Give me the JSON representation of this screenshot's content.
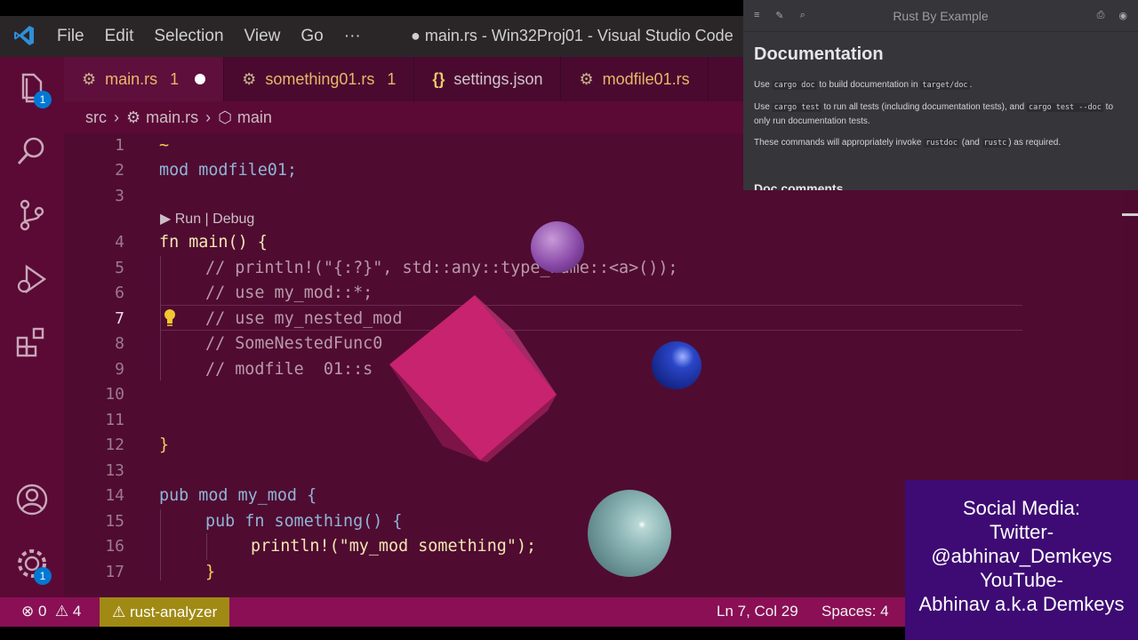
{
  "window": {
    "title": "● main.rs - Win32Proj01 - Visual Studio Code",
    "menu": [
      "File",
      "Edit",
      "Selection",
      "View",
      "Go",
      "···"
    ]
  },
  "activity_bar": {
    "explorer_badge": "1",
    "settings_badge": "1"
  },
  "tabs": [
    {
      "label": "main.rs",
      "count": "1",
      "dirty": true
    },
    {
      "label": "something01.rs",
      "count": "1"
    },
    {
      "label": "settings.json"
    },
    {
      "label": "modfile01.rs"
    }
  ],
  "breadcrumb": {
    "folder": "src",
    "file": "main.rs",
    "symbol": "main"
  },
  "editor": {
    "code_lens": "▶ Run | Debug",
    "lines": [
      {
        "n": "1",
        "text": "~"
      },
      {
        "n": "2",
        "text": "mod modfile01;"
      },
      {
        "n": "3",
        "text": ""
      },
      {
        "n": "4",
        "text": "fn main() {"
      },
      {
        "n": "5",
        "text": "// println!(\"{:?}\", std::any::type_name::<a>());"
      },
      {
        "n": "6",
        "text": "// use my_mod::*;"
      },
      {
        "n": "7",
        "text": "// use my_nested_mod"
      },
      {
        "n": "8",
        "text": "// SomeNestedFunc0"
      },
      {
        "n": "9",
        "text": "// modfile  01::s"
      },
      {
        "n": "10",
        "text": ""
      },
      {
        "n": "11",
        "text": ""
      },
      {
        "n": "12",
        "text": "}"
      },
      {
        "n": "13",
        "text": ""
      },
      {
        "n": "14",
        "text": "pub mod my_mod {"
      },
      {
        "n": "15",
        "text": "pub fn something() {"
      },
      {
        "n": "16",
        "text": "println!(\"my_mod something\");"
      },
      {
        "n": "17",
        "text": "}"
      }
    ]
  },
  "rust_by_example": {
    "title": "Rust By Example",
    "heading": "Documentation",
    "p1_a": "Use ",
    "p1_code": "cargo doc",
    "p1_b": " to build documentation in ",
    "p1_code2": "target/doc",
    "p1_c": ".",
    "p2_a": "Use ",
    "p2_code": "cargo test",
    "p2_b": " to run all tests (including documentation tests), and ",
    "p2_code2": "cargo test --doc",
    "p2_c": " to only run documentation tests.",
    "p3_a": "These commands will appropriately invoke ",
    "p3_code": "rustdoc",
    "p3_b": " (and ",
    "p3_code2": "rustc",
    "p3_c": ") as required.",
    "h2": "Doc comments"
  },
  "status_bar": {
    "errors": "0",
    "warnings": "4",
    "analyzer": "rust-analyzer",
    "position": "Ln 7, Col 29",
    "spaces": "Spaces: 4"
  },
  "social": {
    "line1": "Social Media:",
    "line2": "Twitter-",
    "line3": "@abhinav_Demkeys",
    "line4": "YouTube-",
    "line5": "Abhinav a.k.a Demkeys"
  },
  "colors": {
    "editor_bg": "#500b31",
    "activity_bg": "#5a0a35",
    "status_bg": "#8a0f55",
    "social_bg": "#3d0b73"
  }
}
